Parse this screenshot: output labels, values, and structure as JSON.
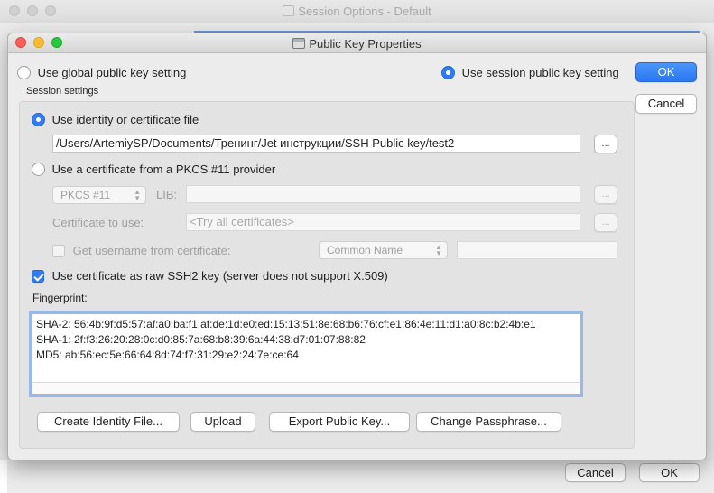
{
  "background_window": {
    "title": "Session Options - Default",
    "cancel_label": "Cancel",
    "ok_label": "OK"
  },
  "dialog": {
    "title": "Public Key Properties",
    "ok_label": "OK",
    "cancel_label": "Cancel",
    "use_global_label": "Use global public key setting",
    "use_session_label": "Use session public key setting",
    "session_settings_label": "Session settings"
  },
  "identity": {
    "use_identity_label": "Use identity or certificate file",
    "path_value": "/Users/ArtemiySP/Documents/Тренинг/Jet инструкции/SSH Public key/test2",
    "browse_label": "...",
    "use_pkcs_label": "Use a certificate from a PKCS #11 provider",
    "pkcs_select_value": "PKCS #11",
    "lib_label": "LIB:",
    "lib_browse_label": "...",
    "cert_to_use_label": "Certificate to use:",
    "cert_placeholder": "<Try all certificates>",
    "cert_browse_label": "...",
    "get_username_label": "Get username from certificate:",
    "common_name_value": "Common Name",
    "raw_ssh2_label": "Use certificate as raw SSH2 key (server does not support X.509)"
  },
  "fingerprint": {
    "label": "Fingerprint:",
    "lines": [
      "SHA-2: 56:4b:9f:d5:57:af:a0:ba:f1:af:de:1d:e0:ed:15:13:51:8e:68:b6:76:cf:e1:86:4e:11:d1:a0:8c:b2:4b:e1",
      "SHA-1: 2f:f3:26:20:28:0c:d0:85:7a:68:b8:39:6a:44:38:d7:01:07:88:82",
      "MD5: ab:56:ec:5e:66:64:8d:74:f7:31:29:e2:24:7e:ce:64"
    ]
  },
  "actions": {
    "create_identity_label": "Create Identity File...",
    "upload_label": "Upload",
    "export_label": "Export Public Key...",
    "change_passphrase_label": "Change Passphrase..."
  },
  "colors": {
    "accent": "#2f7cf6",
    "close": "#fe5f57",
    "minimize": "#febc2e",
    "maximize": "#28c840"
  }
}
